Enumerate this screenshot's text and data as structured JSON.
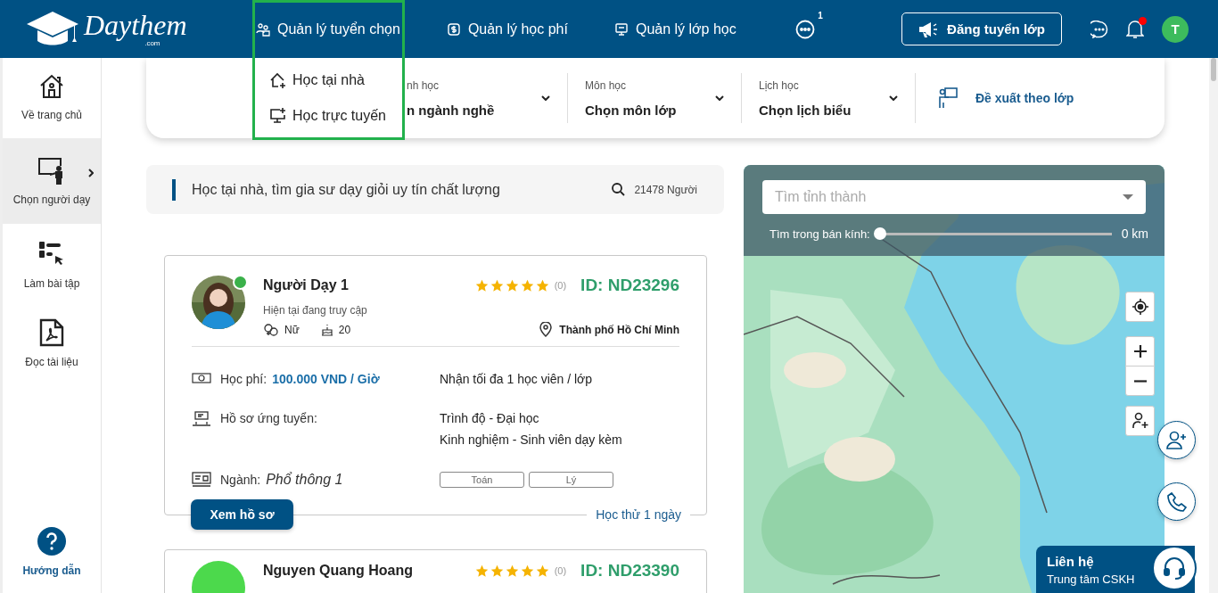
{
  "header": {
    "logo": "Daythem",
    "logo_sub": ".com",
    "nav": [
      {
        "label": "Quản lý tuyển chọn",
        "kind": "people"
      },
      {
        "label": "Quản lý học phí",
        "kind": "money"
      },
      {
        "label": "Quản lý lớp học",
        "kind": "board"
      }
    ],
    "more_badge": "1",
    "post_button": "Đăng tuyển lớp",
    "notification_dot": true,
    "avatar_initial": "T"
  },
  "dropdown": {
    "items": [
      {
        "label": "Học tại nhà",
        "kind": "home"
      },
      {
        "label": "Học trực tuyến",
        "kind": "screen"
      }
    ]
  },
  "sidebar": {
    "items": [
      {
        "label": "Về trang chủ",
        "selected": false,
        "kind": "home"
      },
      {
        "label": "Chọn người dạy",
        "selected": true,
        "kind": "teacher"
      },
      {
        "label": "Làm bài tập",
        "selected": false,
        "kind": "quiz"
      },
      {
        "label": "Đọc tài liệu",
        "selected": false,
        "kind": "pdf"
      }
    ],
    "help": "Hướng dẫn"
  },
  "filters": [
    {
      "label": "nh học",
      "value": "n ngành nghề"
    },
    {
      "label": "Môn học",
      "value": "Chọn môn lớp"
    },
    {
      "label": "Lịch học",
      "value": "Chọn lịch biểu"
    }
  ],
  "suggest": "Đề xuất theo lớp",
  "search_banner": {
    "title": "Học tại nhà, tìm gia sư dạy giỏi uy tín chất lượng",
    "count": "21478 Người"
  },
  "tutors": [
    {
      "name": "Người Dạy 1",
      "online": true,
      "status": "Hiện tại đang truy cập",
      "gender": "Nữ",
      "age": "20",
      "stars": 5,
      "reviews": "(0)",
      "id": "ID: ND23296",
      "location": "Thành phố Hồ Chí Minh",
      "fee_label": "Học phí:",
      "fee": "100.000 VND / Giờ",
      "capacity": "Nhận tối đa 1 học viên / lớp",
      "profile_label": "Hồ sơ ứng tuyển:",
      "profile_lines": [
        "Trình độ - Đại học",
        "Kinh nghiệm - Sinh viên dạy kèm"
      ],
      "major_label": "Ngành:",
      "major": "Phổ thông 1",
      "subjects": [
        "Toán",
        "Lý"
      ],
      "button": "Xem hồ sơ",
      "trial": "Học thử 1 ngày"
    },
    {
      "name": "Nguyen Quang Hoang",
      "color": "#4cd94c",
      "online": false,
      "stars": 5,
      "reviews": "(0)",
      "id": "ID: ND23390"
    }
  ],
  "map": {
    "kind": "picture",
    "search_placeholder": "Tìm tỉnh thành",
    "radius": {
      "label": "Tìm trong bán kính:",
      "level": 0,
      "value": "0 km"
    }
  },
  "contact": {
    "title": "Liên hệ",
    "subtitle": "Trung tâm CSKH"
  }
}
